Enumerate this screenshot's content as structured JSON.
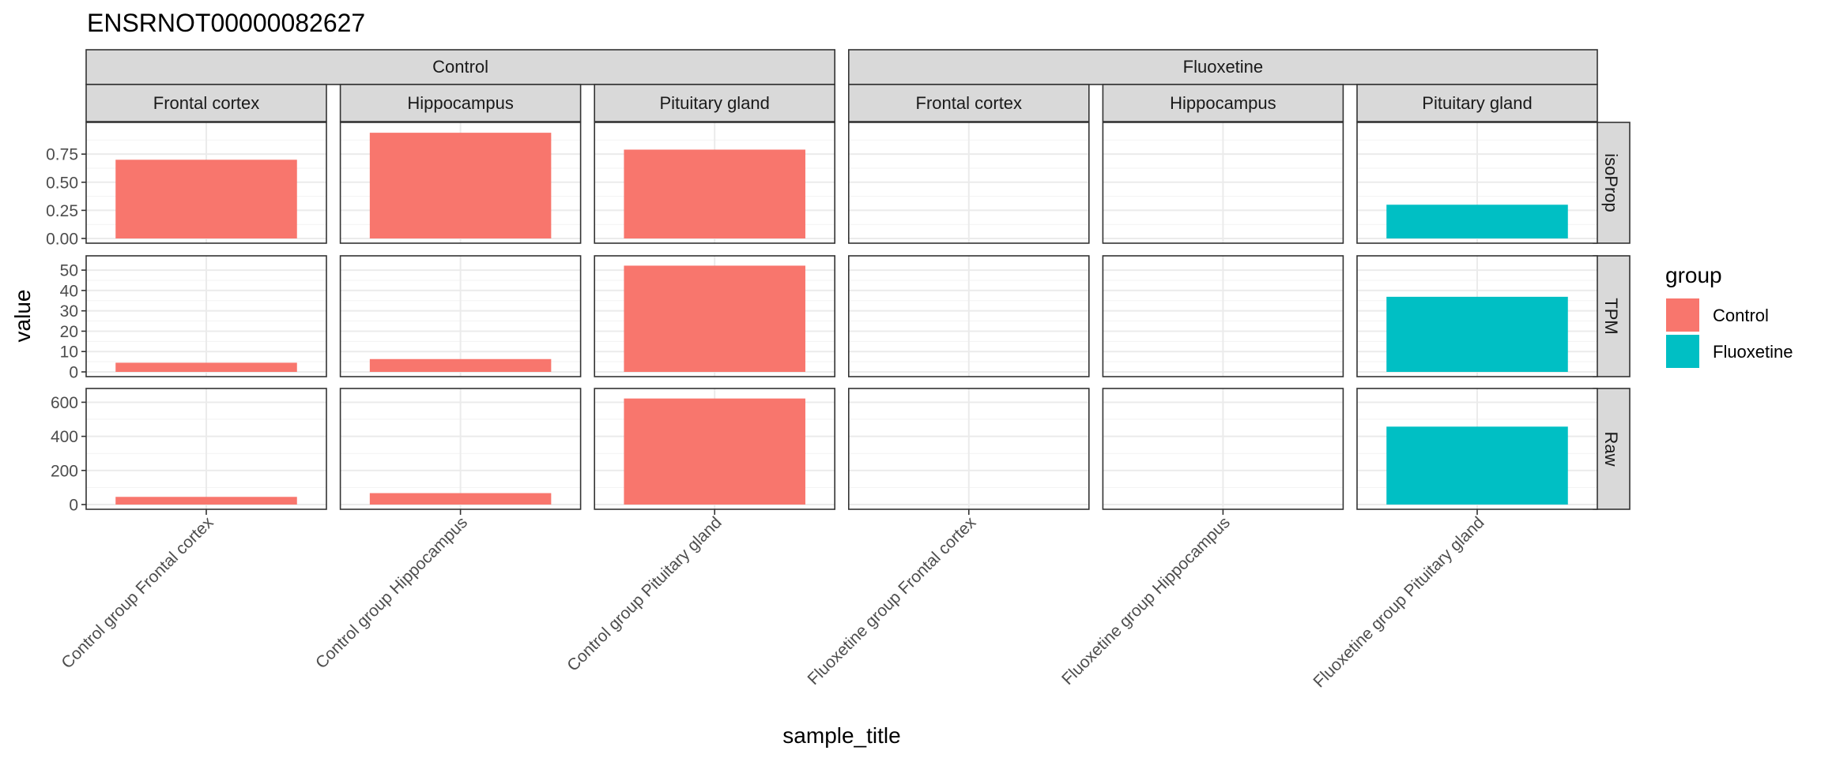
{
  "chart_data": {
    "type": "bar",
    "title": "ENSRNOT00000082627",
    "xlabel": "sample_title",
    "ylabel": "value",
    "col_facets": [
      {
        "label": "Control",
        "subfacets": [
          "Frontal cortex",
          "Hippocampus",
          "Pituitary gland"
        ]
      },
      {
        "label": "Fluoxetine",
        "subfacets": [
          "Frontal cortex",
          "Hippocampus",
          "Pituitary gland"
        ]
      }
    ],
    "categories": [
      "Control group Frontal cortex",
      "Control group Hippocampus",
      "Control group Pituitary gland",
      "Fluoxetine group Frontal cortex",
      "Fluoxetine group Hippocampus",
      "Fluoxetine group Pituitary gland"
    ],
    "category_group": [
      "Control",
      "Control",
      "Control",
      "Fluoxetine",
      "Fluoxetine",
      "Fluoxetine"
    ],
    "row_facets": [
      {
        "label": "isoProp",
        "ylim": [
          0,
          0.99
        ],
        "ticks": [
          0,
          0.25,
          0.5,
          0.75
        ],
        "tick_labels": [
          "0.00",
          "0.25",
          "0.50",
          "0.75"
        ],
        "minor_ticks": [
          0.125,
          0.375,
          0.625,
          0.875
        ],
        "values": [
          0.7,
          0.94,
          0.79,
          null,
          null,
          0.3
        ]
      },
      {
        "label": "TPM",
        "ylim": [
          0,
          54.7
        ],
        "ticks": [
          0,
          10,
          20,
          30,
          40,
          50
        ],
        "tick_labels": [
          "0",
          "10",
          "20",
          "30",
          "40",
          "50"
        ],
        "minor_ticks": [
          5,
          15,
          25,
          35,
          45
        ],
        "values": [
          4.5,
          6.3,
          52.2,
          null,
          null,
          36.9
        ]
      },
      {
        "label": "Raw",
        "ylim": [
          0,
          653
        ],
        "ticks": [
          0,
          200,
          400,
          600
        ],
        "tick_labels": [
          "0",
          "200",
          "400",
          "600"
        ],
        "minor_ticks": [
          100,
          300,
          500
        ],
        "values": [
          45,
          67,
          622,
          null,
          null,
          457
        ]
      }
    ],
    "legend": {
      "title": "group",
      "position": "right",
      "items": [
        {
          "label": "Control",
          "color": "#F8766D"
        },
        {
          "label": "Fluoxetine",
          "color": "#00BFC4"
        }
      ]
    },
    "grid": true,
    "theme": "bw"
  }
}
